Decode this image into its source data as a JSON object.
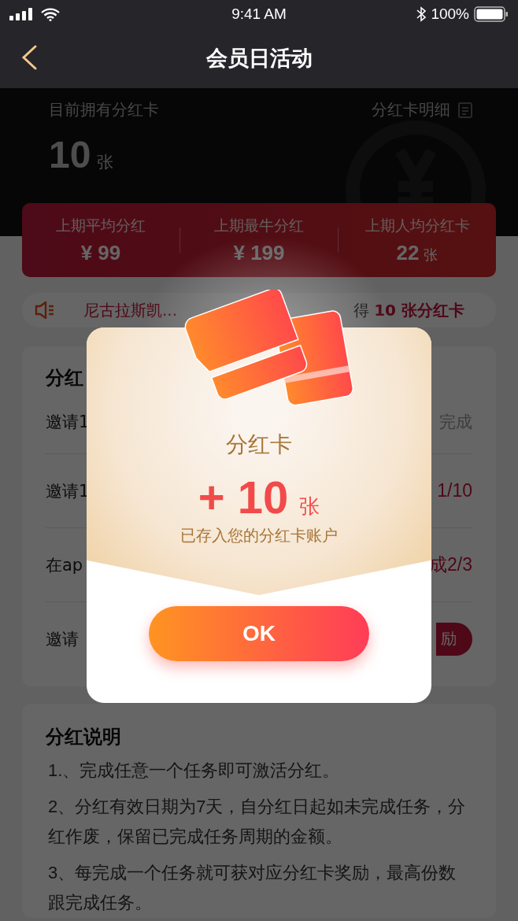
{
  "status_bar": {
    "time": "9:41 AM",
    "battery": "100%"
  },
  "nav": {
    "title": "会员日活动"
  },
  "summary": {
    "label": "目前拥有分红卡",
    "count": "10",
    "unit": "张",
    "detail_link": "分红卡明细"
  },
  "stats": [
    {
      "label": "上期平均分红",
      "value": "¥ 99"
    },
    {
      "label": "上期最牛分红",
      "value": "¥ 199"
    },
    {
      "label": "上期人均分红卡",
      "value": "22",
      "unit": "张"
    }
  ],
  "notice": {
    "name": "尼古拉斯凯...",
    "text": "得",
    "highlight": "10 张分红卡"
  },
  "tasks": {
    "title": "分红",
    "rows": [
      {
        "label": "邀请1",
        "status": "完成",
        "kind": "done"
      },
      {
        "label": "邀请1",
        "status": "1/10",
        "kind": "progress"
      },
      {
        "label": "在ap",
        "status": "成2/3",
        "kind": "progress"
      },
      {
        "label": "邀请",
        "status": "励",
        "kind": "button"
      }
    ]
  },
  "rules": {
    "title": "分红说明",
    "items": [
      "1.、完成任意一个任务即可激活分红。",
      "2、分红有效日期为7天，自分红日起如未完成任务，分红作废，保留已完成任务周期的金额。",
      "3、每完成一个任务就可获对应分红卡奖励，最高份数跟完成任务。"
    ]
  },
  "dialog": {
    "title": "分红卡",
    "amount": "+ 10",
    "unit": "张",
    "note": "已存入您的分红卡账户",
    "button": "OK"
  }
}
